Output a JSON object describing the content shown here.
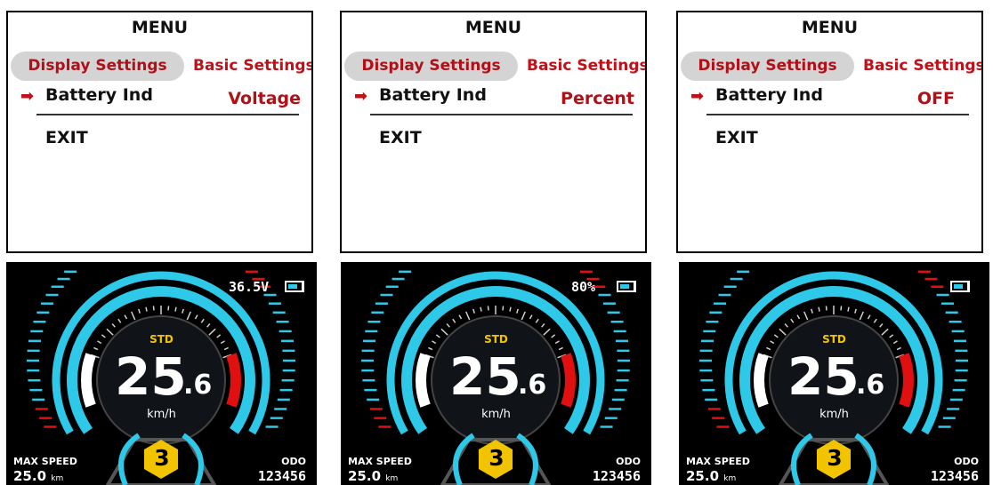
{
  "menus": [
    {
      "title": "MENU",
      "tab_active": "Display Settings",
      "tab_other": "Basic Settings",
      "arrow": "➡",
      "item_label": "Battery Ind",
      "item_value": "Voltage",
      "exit": "EXIT"
    },
    {
      "title": "MENU",
      "tab_active": "Display Settings",
      "tab_other": "Basic Settings",
      "arrow": "➡",
      "item_label": "Battery Ind",
      "item_value": "Percent",
      "exit": "EXIT"
    },
    {
      "title": "MENU",
      "tab_active": "Display Settings",
      "tab_other": "Basic Settings",
      "arrow": "➡",
      "item_label": "Battery Ind",
      "item_value": "OFF",
      "exit": "EXIT"
    }
  ],
  "dashboards": [
    {
      "battery_text": "36.5V",
      "mode": "STD",
      "speed_int": "25",
      "speed_dec": ".6",
      "speed_unit": "km/h",
      "max_label": "MAX SPEED",
      "max_value": "25.0",
      "max_unit": "km",
      "odo_label": "ODO",
      "odo_value": "123456",
      "gear": "3"
    },
    {
      "battery_text": "80%",
      "mode": "STD",
      "speed_int": "25",
      "speed_dec": ".6",
      "speed_unit": "km/h",
      "max_label": "MAX SPEED",
      "max_value": "25.0",
      "max_unit": "km",
      "odo_label": "ODO",
      "odo_value": "123456",
      "gear": "3"
    },
    {
      "battery_text": "",
      "mode": "STD",
      "speed_int": "25",
      "speed_dec": ".6",
      "speed_unit": "km/h",
      "max_label": "MAX SPEED",
      "max_value": "25.0",
      "max_unit": "km",
      "odo_label": "ODO",
      "odo_value": "123456",
      "gear": "3"
    }
  ],
  "colors": {
    "accent_red": "#b01018",
    "cyan": "#2ec8e8",
    "gear_yellow": "#f2c400",
    "tab_bg": "#d4d4d4"
  }
}
